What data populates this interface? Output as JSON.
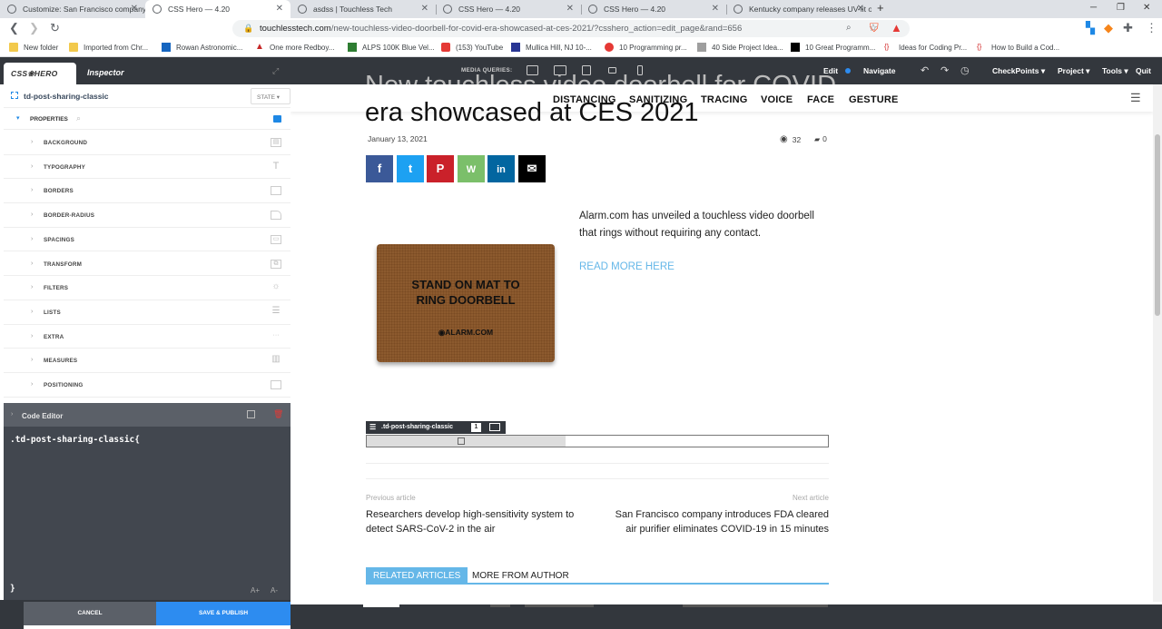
{
  "browser": {
    "tabs": [
      {
        "title": "Customize: San Francisco company in",
        "active": false
      },
      {
        "title": "CSS Hero — 4.20",
        "active": true
      },
      {
        "title": "asdss | Touchless Tech",
        "active": false
      },
      {
        "title": "CSS Hero — 4.20",
        "active": false
      },
      {
        "title": "CSS Hero — 4.20",
        "active": false
      },
      {
        "title": "Kentucky company releases UV-lit offi",
        "active": false
      }
    ],
    "url_host": "touchlesstech.com",
    "url_path": "/new-touchless-video-doorbell-for-covid-era-showcased-at-ces-2021/?csshero_action=edit_page&rand=656",
    "bookmarks": [
      "New folder",
      "Imported from Chr...",
      "Rowan Astronomic...",
      "One more Redboy...",
      "ALPS 100K Blue Vel...",
      "(153) YouTube",
      "Mullica Hill, NJ 10-...",
      "10 Programming pr...",
      "40 Side Project Idea...",
      "10 Great Programm...",
      "Ideas for Coding Pr...",
      "How to Build a Cod..."
    ]
  },
  "panel": {
    "brand": "CSS❀HERO",
    "inspector": "Inspector",
    "selector": "td-post-sharing-classic",
    "state": "STATE ▾",
    "properties_label": "PROPERTIES",
    "properties": [
      "BACKGROUND",
      "TYPOGRAPHY",
      "BORDERS",
      "BORDER-RADIUS",
      "SPACINGS",
      "TRANSFORM",
      "FILTERS",
      "LISTS",
      "EXTRA",
      "MEASURES",
      "POSITIONING"
    ],
    "code_editor_title": "Code Editor",
    "code_line": ".td-post-sharing-classic{",
    "code_end": "}",
    "font_up": "A+",
    "font_down": "A-",
    "cancel": "CANCEL",
    "save_publish": "SAVE & PUBLISH"
  },
  "toolbar": {
    "media_queries": "MEDIA QUERIES:",
    "edit": "Edit",
    "navigate": "Navigate",
    "checkpoints": "CheckPoints ▾",
    "project": "Project ▾",
    "tools": "Tools ▾",
    "quit": "Quit"
  },
  "site_menu": [
    "DISTANCING",
    "SANITIZING",
    "TRACING",
    "VOICE",
    "FACE",
    "GESTURE"
  ],
  "article": {
    "title_top": "New touchless video doorbell for COVID",
    "title_bottom": "era showcased at CES 2021",
    "date": "January 13, 2021",
    "views": "32",
    "comments": "0",
    "share_buttons": [
      "f",
      "t",
      "P",
      "W",
      "in",
      "✉"
    ],
    "image_text": "STAND ON MAT TO RING DOORBELL",
    "image_logo": "◉ALARM.COM",
    "excerpt": "Alarm.com has unveiled a touchless video doorbell that rings without requiring any contact.",
    "read_more": "READ MORE HERE",
    "highlight_label": ".td-post-sharing-classic",
    "highlight_count": "1",
    "prev_label": "Previous article",
    "prev_title": "Researchers develop high-sensitivity system to detect SARS-CoV-2 in the air",
    "next_label": "Next article",
    "next_title": "San Francisco company introduces FDA cleared air purifier eliminates COVID-19 in 15 minutes",
    "related_tab": "RELATED ARTICLES",
    "more_tab": "MORE FROM AUTHOR"
  },
  "colors": {
    "accent": "#2d8cf0",
    "panel_dark": "#33373d",
    "read_more": "#65b7e8",
    "facebook": "#3b5998",
    "twitter": "#1da1f2",
    "pinterest": "#ca212a",
    "whatsapp": "#7bbf6a",
    "linkedin": "#0266a0",
    "email": "#000000"
  }
}
